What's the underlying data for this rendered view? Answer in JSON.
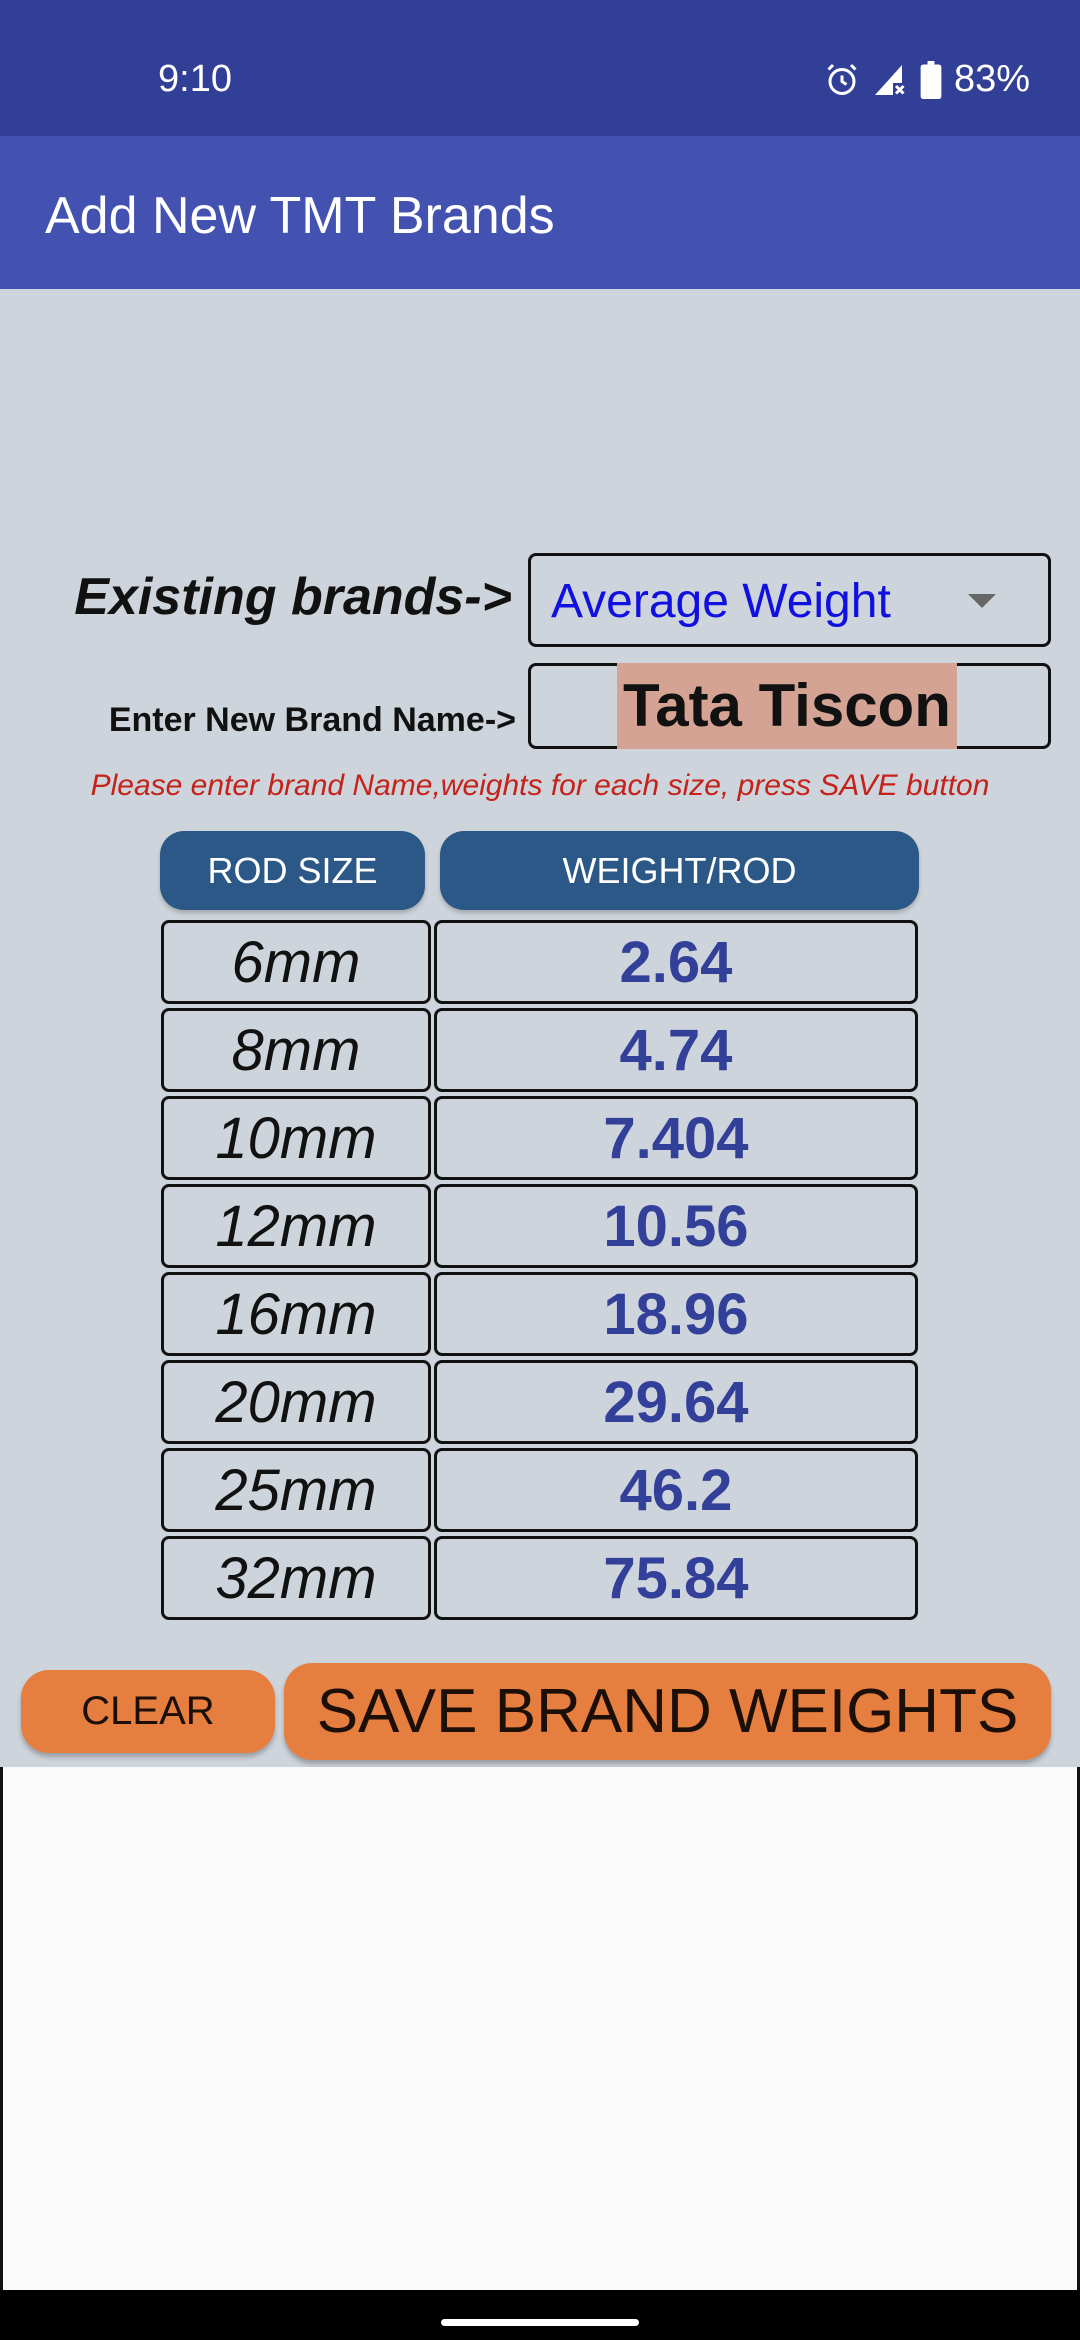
{
  "status_bar": {
    "time": "9:10",
    "battery": "83%",
    "icons": [
      "alarm-icon",
      "signal-off-icon",
      "battery-icon"
    ]
  },
  "app_bar": {
    "title": "Add New TMT Brands"
  },
  "form": {
    "existing_label": "Existing brands->",
    "existing_selected": "Average Weight",
    "name_label": "Enter New Brand Name->",
    "name_value": "Tata Tiscon",
    "hint": "Please enter brand Name,weights for each size, press SAVE button"
  },
  "table": {
    "headers": [
      "ROD SIZE",
      "WEIGHT/ROD"
    ],
    "rows": [
      {
        "size": "6mm",
        "weight": "2.64"
      },
      {
        "size": "8mm",
        "weight": "4.74"
      },
      {
        "size": "10mm",
        "weight": "7.404"
      },
      {
        "size": "12mm",
        "weight": "10.56"
      },
      {
        "size": "16mm",
        "weight": "18.96"
      },
      {
        "size": "20mm",
        "weight": "29.64"
      },
      {
        "size": "25mm",
        "weight": "46.2"
      },
      {
        "size": "32mm",
        "weight": "75.84"
      }
    ]
  },
  "buttons": {
    "clear": "CLEAR",
    "save": "SAVE BRAND WEIGHTS"
  },
  "colors": {
    "status_bar": "#323f96",
    "app_bar": "#4352b0",
    "header": "#2b5886",
    "button": "#e67e40",
    "weight_text": "#33409a",
    "hint": "#c4221a"
  }
}
